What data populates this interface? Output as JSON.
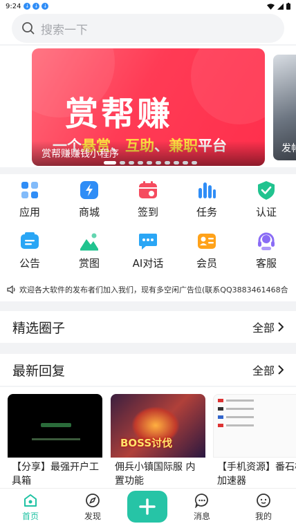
{
  "status_bar": {
    "time": "9:24"
  },
  "search": {
    "placeholder": "搜索一下"
  },
  "banner": {
    "headline": "赏帮赚",
    "sub_parts": [
      "一个",
      "悬赏",
      "、",
      "互助",
      "、",
      "兼职",
      "平台"
    ],
    "caption": "赏帮赚赚钱小程序",
    "next_caption": "发帖",
    "slide_count": 10,
    "active_slide": 0
  },
  "grid_items": [
    {
      "label": "应用",
      "icon": "apps-icon",
      "color": "#2f8df6"
    },
    {
      "label": "商城",
      "icon": "lightning-icon",
      "color": "#2f8df6"
    },
    {
      "label": "签到",
      "icon": "calendar-icon",
      "color": "#f54b5e"
    },
    {
      "label": "任务",
      "icon": "bar-chart-icon",
      "color": "#2f8df6"
    },
    {
      "label": "认证",
      "icon": "shield-check-icon",
      "color": "#21c38f"
    },
    {
      "label": "公告",
      "icon": "notice-icon",
      "color": "#2aa6f5"
    },
    {
      "label": "赏图",
      "icon": "image-icon",
      "color": "#21c38f"
    },
    {
      "label": "AI对话",
      "icon": "chat-icon",
      "color": "#2aa6f5"
    },
    {
      "label": "会员",
      "icon": "vip-card-icon",
      "color": "#ffa21a"
    },
    {
      "label": "客服",
      "icon": "headset-icon",
      "color": "#8a6cf5"
    }
  ],
  "notice": {
    "text": "欢迎各大软件的发布者们加入我们，现有多空闲广告位(联系QQ3883461468合"
  },
  "sections": {
    "featured": {
      "title": "精选圈子",
      "more": "全部"
    },
    "latest": {
      "title": "最新回复",
      "more": "全部"
    }
  },
  "cards": [
    {
      "title": "【分享】最强开户工具箱"
    },
    {
      "title": "佣兵小镇国际服 内置功能"
    },
    {
      "title": "【手机资源】番石榴加速器"
    }
  ],
  "card_thumb_texts": {
    "boss": "BOSS讨伐"
  },
  "tabs": [
    {
      "label": "首页",
      "icon": "home-icon",
      "active": true
    },
    {
      "label": "发现",
      "icon": "compass-icon",
      "active": false
    },
    {
      "label": "消息",
      "icon": "message-icon",
      "active": false
    },
    {
      "label": "我的",
      "icon": "profile-icon",
      "active": false
    }
  ],
  "colors": {
    "accent": "#26c4a6",
    "banner": "#ff3b55"
  }
}
